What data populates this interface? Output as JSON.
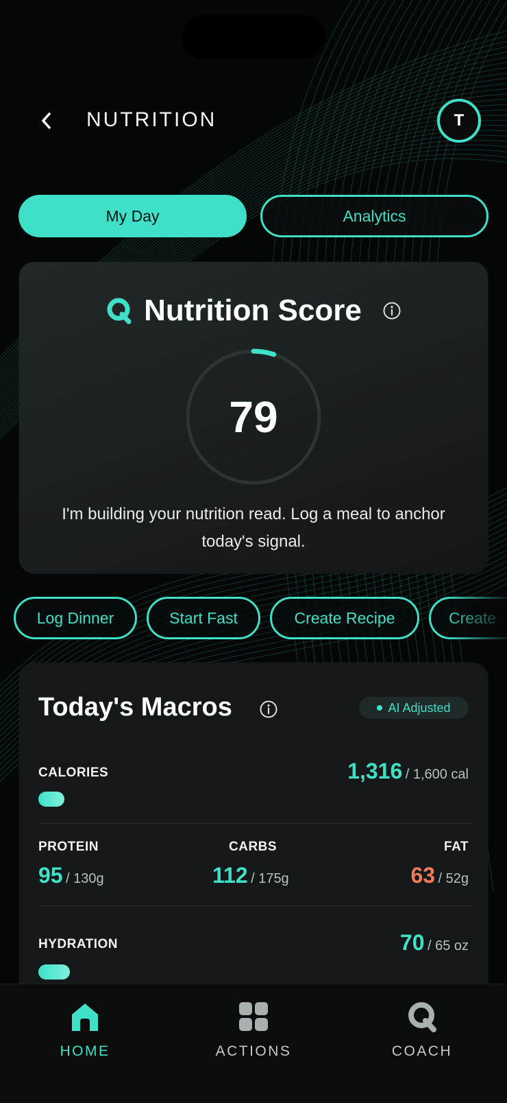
{
  "header": {
    "title": "NUTRITION",
    "avatar_initial": "T"
  },
  "tabs": [
    {
      "label": "My Day",
      "active": true
    },
    {
      "label": "Analytics",
      "active": false
    }
  ],
  "score_card": {
    "title": "Nutrition Score",
    "score": "79",
    "progress_fraction": 0.05,
    "message": "I'm building your nutrition read. Log a meal to anchor today's signal."
  },
  "chips": [
    "Log Dinner",
    "Start Fast",
    "Create Recipe",
    "Create"
  ],
  "macros": {
    "title": "Today's Macros",
    "badge": "AI Adjusted",
    "calories": {
      "label": "CALORIES",
      "value": "1,316",
      "target": "/ 1,600 cal"
    },
    "protein": {
      "label": "PROTEIN",
      "value": "95",
      "target": "/ 130g"
    },
    "carbs": {
      "label": "CARBS",
      "value": "112",
      "target": "/ 175g"
    },
    "fat": {
      "label": "FAT",
      "value": "63",
      "target": "/ 52g"
    },
    "hydration": {
      "label": "HYDRATION",
      "value": "70",
      "target": "/ 65 oz"
    }
  },
  "nav": {
    "home": "HOME",
    "actions": "ACTIONS",
    "coach": "COACH"
  },
  "colors": {
    "accent": "#3ee0c8",
    "over_target": "#f07a5c",
    "background": "#050606",
    "card": "#151818"
  }
}
